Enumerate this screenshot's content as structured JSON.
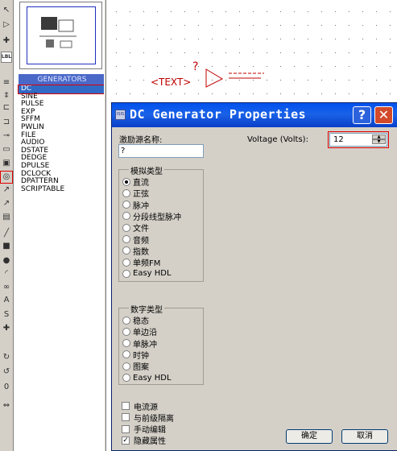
{
  "left_panel": {
    "tools": [
      {
        "icon": "selection-arrow-icon",
        "glyph": "↖"
      },
      {
        "icon": "component-mode-icon",
        "glyph": "▷"
      },
      {
        "icon": "junction-dot-icon",
        "glyph": "✚"
      },
      {
        "icon": "wire-label-icon",
        "glyph": "LBL"
      },
      {
        "icon": "text-script-icon",
        "glyph": "≡"
      },
      {
        "icon": "bus-icon",
        "glyph": "‡"
      },
      {
        "icon": "subcircuit-icon",
        "glyph": "⊏"
      },
      {
        "icon": "terminal-icon",
        "glyph": "⊐"
      },
      {
        "icon": "device-pin-icon",
        "glyph": "⊸"
      },
      {
        "icon": "graph-icon",
        "glyph": "▭"
      },
      {
        "icon": "tape-recorder-icon",
        "glyph": "▣"
      },
      {
        "icon": "generator-icon",
        "glyph": "◎"
      },
      {
        "icon": "voltage-probe-icon",
        "glyph": "↗"
      },
      {
        "icon": "current-probe-icon",
        "glyph": "↗"
      },
      {
        "icon": "virtual-instrument-icon",
        "glyph": "▤"
      },
      {
        "icon": "line-icon",
        "glyph": "╱"
      },
      {
        "icon": "box-icon",
        "glyph": "■"
      },
      {
        "icon": "circle-icon",
        "glyph": "●"
      },
      {
        "icon": "arc-icon",
        "glyph": "◜"
      },
      {
        "icon": "path-icon",
        "glyph": "∞"
      },
      {
        "icon": "text-icon",
        "glyph": "A"
      },
      {
        "icon": "symbol-icon",
        "glyph": "S"
      },
      {
        "icon": "marker-icon",
        "glyph": "✚"
      },
      {
        "icon": "rotate-clockwise-icon",
        "glyph": "↻"
      },
      {
        "icon": "rotate-anticlockwise-icon",
        "glyph": "↺"
      },
      {
        "icon": "rotation-value-icon",
        "glyph": "0"
      },
      {
        "icon": "mirror-icon",
        "glyph": "⇔"
      }
    ],
    "rotation_value": "0",
    "generators_header": "GENERATORS",
    "generators": [
      "DC",
      "SINE",
      "PULSE",
      "EXP",
      "SFFM",
      "PWLIN",
      "FILE",
      "AUDIO",
      "DSTATE",
      "DEDGE",
      "DPULSE",
      "DCLOCK",
      "DPATTERN",
      "SCRIPTABLE"
    ],
    "selected_generator": "DC"
  },
  "workspace": {
    "question_mark": "?",
    "text_tag": "<TEXT>"
  },
  "dialog": {
    "title": "DC Generator Properties",
    "help_label": "?",
    "close_label": "✕",
    "stimulus_name_label": "激励源名称:",
    "stimulus_name_value": "?",
    "analog_group_title": "模拟类型",
    "analog_types": [
      "直流",
      "正弦",
      "脉冲",
      "分段线型脉冲",
      "文件",
      "音频",
      "指数",
      "单频FM",
      "Easy HDL"
    ],
    "analog_selected": "直流",
    "digital_group_title": "数字类型",
    "digital_types": [
      "稳态",
      "单边沿",
      "单脉冲",
      "时钟",
      "图案",
      "Easy HDL"
    ],
    "checkboxes": [
      {
        "label": "电流源",
        "checked": false
      },
      {
        "label": "与前级隔离",
        "checked": false
      },
      {
        "label": "手动编辑",
        "checked": false
      },
      {
        "label": "隐藏属性",
        "checked": true
      }
    ],
    "voltage_label": "Voltage (Volts):",
    "voltage_value": "12",
    "ok_label": "确定",
    "cancel_label": "取消"
  }
}
